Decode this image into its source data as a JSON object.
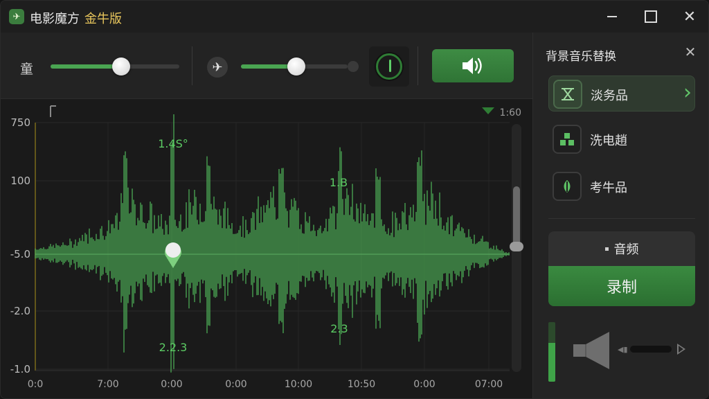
{
  "app": {
    "title": "电影魔方",
    "edition": "金牛版",
    "icon": "airplane-icon"
  },
  "toolbar": {
    "label": "童",
    "slider1_value": 0.55,
    "slider2_value": 0.52
  },
  "waveform": {
    "top_marker": "1:60",
    "y_ticks": [
      "750",
      "100",
      "-5.0",
      "-2.0",
      "-1.0"
    ],
    "x_ticks": [
      "0:0",
      "7:00",
      "0:00",
      "0:00",
      "10:00",
      "10:50",
      "0:00",
      "07:00"
    ],
    "annotations": [
      "1.4S°",
      "1.B",
      "2.3",
      "2.2.3"
    ],
    "accent": "#4aa552"
  },
  "panel": {
    "title": "背景音乐替换",
    "tracks": [
      {
        "label": "淡务品",
        "icon": "disc-waves-icon"
      },
      {
        "label": "洗电趙",
        "icon": "blocks-icon"
      },
      {
        "label": "考牛品",
        "icon": "leaf-icon"
      }
    ],
    "audio_tab": "音频",
    "record_label": "录制",
    "level": 0.65
  }
}
